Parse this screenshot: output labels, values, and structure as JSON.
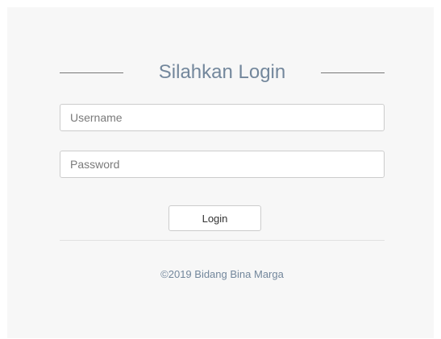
{
  "login_form": {
    "title": "Silahkan Login",
    "username_placeholder": "Username",
    "username_value": "",
    "password_placeholder": "Password",
    "password_value": "",
    "login_button_label": "Login"
  },
  "footer": {
    "copyright": "©2019 Bidang Bina Marga"
  },
  "colors": {
    "panel_background": "#f7f7f7",
    "title_text": "#73879c",
    "input_border": "#cccccc"
  }
}
